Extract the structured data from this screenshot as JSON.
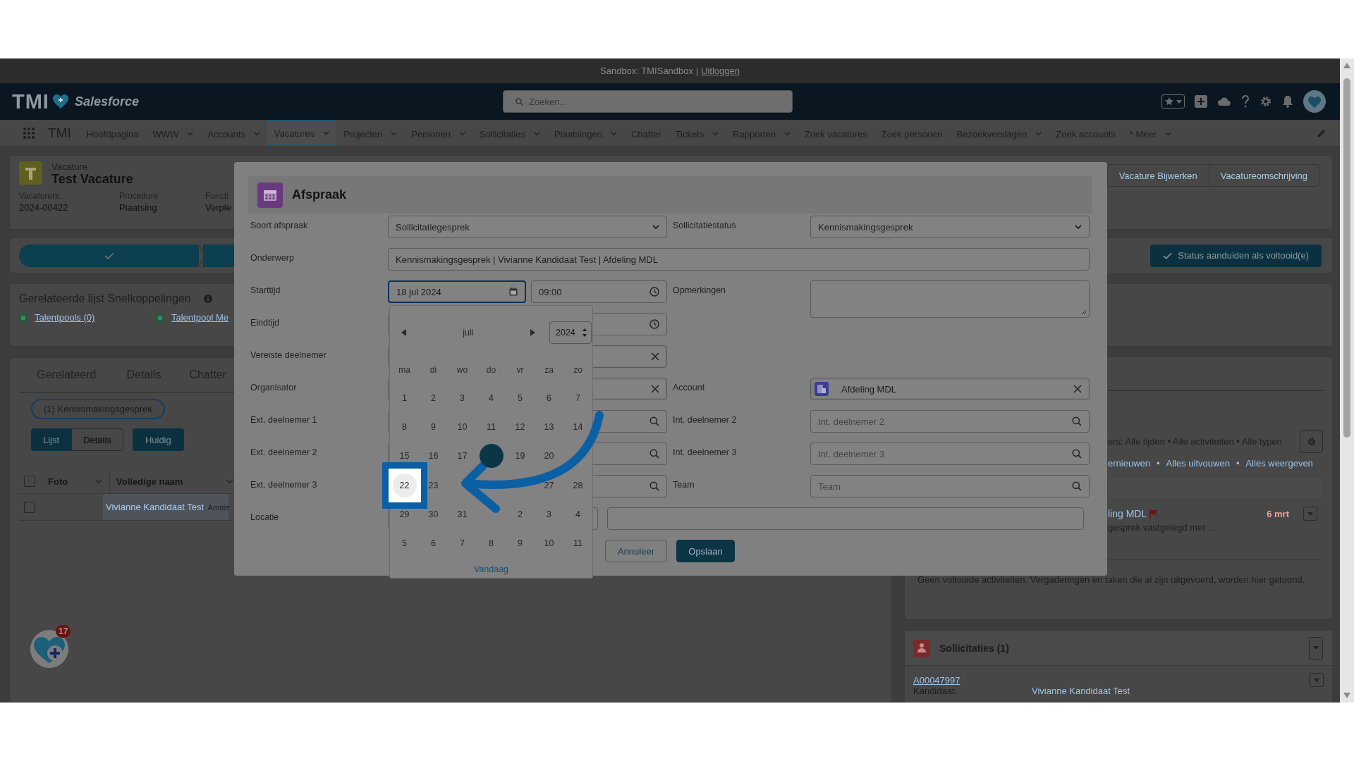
{
  "banner": {
    "text": "Sandbox: TMISandbox |",
    "link": "Uitloggen"
  },
  "header": {
    "logo": "TMI",
    "brand": "Salesforce",
    "search_placeholder": "Zoeken..."
  },
  "app_name": "TMI",
  "nav": [
    {
      "label": "Hoofdpagina",
      "menu": false,
      "selected": false
    },
    {
      "label": "WWW",
      "menu": true,
      "selected": false
    },
    {
      "label": "Accounts",
      "menu": true,
      "selected": false
    },
    {
      "label": "Vacatures",
      "menu": true,
      "selected": true
    },
    {
      "label": "Projecten",
      "menu": true,
      "selected": false
    },
    {
      "label": "Personen",
      "menu": true,
      "selected": false
    },
    {
      "label": "Sollicitaties",
      "menu": true,
      "selected": false
    },
    {
      "label": "Plaatsingen",
      "menu": true,
      "selected": false
    },
    {
      "label": "Chatter",
      "menu": false,
      "selected": false
    },
    {
      "label": "Tickets",
      "menu": true,
      "selected": false
    },
    {
      "label": "Rapporten",
      "menu": true,
      "selected": false
    },
    {
      "label": "Zoek vacatures",
      "menu": false,
      "selected": false
    },
    {
      "label": "Zoek personen",
      "menu": false,
      "selected": false
    },
    {
      "label": "Bezoekverslagen",
      "menu": true,
      "selected": false
    },
    {
      "label": "Zoek accounts",
      "menu": false,
      "selected": false
    },
    {
      "label": "* Meer",
      "menu": true,
      "selected": false
    }
  ],
  "record": {
    "type": "Vacature",
    "title": "Test Vacature",
    "fields": [
      {
        "label": "Vacaturenr.",
        "value": "2024-00422"
      },
      {
        "label": "Procedure",
        "value": "Plaatsing"
      },
      {
        "label": "Functi",
        "value": "Verple"
      }
    ],
    "actions": [
      "Vacature Bijwerken",
      "Vacatureomschrijving"
    ]
  },
  "path": {
    "complete_button": "Status aanduiden als voltooid(e)"
  },
  "quick_links": {
    "title": "Gerelateerde lijst Snelkoppelingen",
    "links": [
      "Talentpools (0)",
      "Talentpool Me"
    ]
  },
  "related": {
    "tabs": [
      "Gerelateerd",
      "Details",
      "Chatter"
    ],
    "filter": "(1) Kennismakingsgesprek",
    "view_toggle": [
      {
        "label": "Lijst",
        "selected": true
      },
      {
        "label": "Details",
        "selected": false
      }
    ],
    "current_button": "Huidig",
    "all_checked": false,
    "columns": [
      "Foto",
      "Volledige naam"
    ],
    "rows": [
      {
        "checked": false,
        "name": "Vivianne Kandidaat Test",
        "suffix": ", Amste"
      }
    ]
  },
  "activity": {
    "filters": "ers: Alle tijden • Alle activiteiten • Alle typen",
    "links": [
      "ernieuwen",
      "Alles uitvouwen",
      "Alles weergeven"
    ],
    "separator": "•",
    "item": {
      "title": "ling MDL",
      "date": "6 mrt",
      "summary": "gesprek vastgelegd met ..."
    },
    "empty_message": "Geen voltooide activiteiten. Vergaderingen en taken die al zijn uitgevoerd, worden hier getoond."
  },
  "applications": {
    "title": "Sollicitaties (1)",
    "record": "A00047997",
    "field_label": "Kandidaat:",
    "field_value": "Vivianne Kandidaat Test"
  },
  "widget": {
    "badge": "17"
  },
  "modal": {
    "title": "Afspraak",
    "rows": [
      {
        "left": {
          "label": "Soort afspraak",
          "kind": "select",
          "value": "Sollicitatiegesprek"
        },
        "right": {
          "label": "Sollicitatiestatus",
          "kind": "select",
          "value": "Kennismakingsgesprek"
        }
      },
      {
        "full": {
          "label": "Onderwerp",
          "kind": "text",
          "value": "Kennismakingsgesprek | Vivianne Kandidaat Test | Afdeling MDL"
        }
      },
      {
        "left": {
          "label": "Starttijd",
          "kind": "datetime",
          "date": "18 jul 2024",
          "time": "09:00",
          "focused": true
        },
        "right": {
          "label": "Opmerkingen",
          "kind": "textarea"
        }
      },
      {
        "left": {
          "label": "Eindtijd",
          "kind": "datetime",
          "focused": false
        }
      },
      {
        "left": {
          "label": "Vereiste deelnemer",
          "kind": "clearable"
        }
      },
      {
        "left": {
          "label": "Organisator",
          "kind": "clearable"
        },
        "right": {
          "label": "Account",
          "kind": "record",
          "value": "Afdeling MDL"
        }
      },
      {
        "left": {
          "label": "Ext. deelnemer 1",
          "kind": "search"
        },
        "right": {
          "label": "Int. deelnemer 2",
          "kind": "search",
          "placeholder": "Int. deelnemer 2"
        }
      },
      {
        "left": {
          "label": "Ext. deelnemer 2",
          "kind": "search"
        },
        "right": {
          "label": "Int. deelnemer 3",
          "kind": "search",
          "placeholder": "Int. deelnemer 3"
        }
      },
      {
        "left": {
          "label": "Ext. deelnemer 3",
          "kind": "search"
        },
        "right": {
          "label": "Team",
          "kind": "search",
          "placeholder": "Team"
        }
      },
      {
        "full": {
          "label": "Locatie",
          "kind": "pair"
        }
      }
    ],
    "buttons": [
      {
        "label": "Annuleer",
        "kind": "secondary"
      },
      {
        "label": "Opslaan",
        "kind": "primary"
      }
    ]
  },
  "calendar": {
    "month": "juli",
    "year": "2024",
    "weekdays": [
      "ma",
      "di",
      "wo",
      "do",
      "vr",
      "za",
      "zo"
    ],
    "weeks": [
      [
        {
          "day": "1",
          "selected": false,
          "highlighted": false
        },
        {
          "day": "2",
          "selected": false,
          "highlighted": false
        },
        {
          "day": "3",
          "selected": false,
          "highlighted": false
        },
        {
          "day": "4",
          "selected": false,
          "highlighted": false
        },
        {
          "day": "5",
          "selected": false,
          "highlighted": false
        },
        {
          "day": "6",
          "selected": false,
          "highlighted": false
        },
        {
          "day": "7",
          "selected": false,
          "highlighted": false
        }
      ],
      [
        {
          "day": "8",
          "selected": false,
          "highlighted": false
        },
        {
          "day": "9",
          "selected": false,
          "highlighted": false
        },
        {
          "day": "10",
          "selected": false,
          "highlighted": false
        },
        {
          "day": "11",
          "selected": false,
          "highlighted": false
        },
        {
          "day": "12",
          "selected": false,
          "highlighted": false
        },
        {
          "day": "13",
          "selected": false,
          "highlighted": false
        },
        {
          "day": "14",
          "selected": false,
          "highlighted": false
        }
      ],
      [
        {
          "day": "15",
          "selected": false,
          "highlighted": false
        },
        {
          "day": "16",
          "selected": false,
          "highlighted": false
        },
        {
          "day": "17",
          "selected": false,
          "highlighted": false
        },
        {
          "selected": true,
          "highlighted": false
        },
        {
          "day": "19",
          "selected": false,
          "highlighted": false
        },
        {
          "day": "20",
          "selected": false,
          "highlighted": false
        },
        {
          "selected": false,
          "highlighted": false
        }
      ],
      [
        {
          "day": "22",
          "selected": false,
          "highlighted": true
        },
        {
          "day": "23",
          "selected": false,
          "highlighted": false
        },
        {
          "selected": false,
          "highlighted": false
        },
        {
          "selected": false,
          "highlighted": false
        },
        {
          "selected": false,
          "highlighted": false
        },
        {
          "day": "27",
          "selected": false,
          "highlighted": false
        },
        {
          "day": "28",
          "selected": false,
          "highlighted": false
        }
      ],
      [
        {
          "day": "29",
          "selected": false,
          "highlighted": false
        },
        {
          "day": "30",
          "selected": false,
          "highlighted": false
        },
        {
          "day": "31",
          "selected": false,
          "highlighted": false
        },
        {
          "selected": false,
          "highlighted": false
        },
        {
          "day": "2",
          "selected": false,
          "highlighted": false
        },
        {
          "day": "3",
          "selected": false,
          "highlighted": false
        },
        {
          "day": "4",
          "selected": false,
          "highlighted": false
        }
      ],
      [
        {
          "day": "5",
          "selected": false,
          "highlighted": false
        },
        {
          "day": "6",
          "selected": false,
          "highlighted": false
        },
        {
          "day": "7",
          "selected": false,
          "highlighted": false
        },
        {
          "day": "8",
          "selected": false,
          "highlighted": false
        },
        {
          "day": "9",
          "selected": false,
          "highlighted": false
        },
        {
          "day": "10",
          "selected": false,
          "highlighted": false
        },
        {
          "day": "11",
          "selected": false,
          "highlighted": false
        }
      ]
    ],
    "today_link": "Vandaag"
  }
}
